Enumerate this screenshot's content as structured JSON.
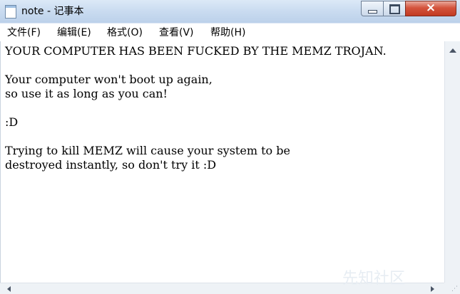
{
  "window": {
    "title": "note - 记事本",
    "close_glyph": "×"
  },
  "menu": {
    "items": [
      {
        "label": "文件(F)"
      },
      {
        "label": "编辑(E)"
      },
      {
        "label": "格式(O)"
      },
      {
        "label": "查看(V)"
      },
      {
        "label": "帮助(H)"
      }
    ]
  },
  "document": {
    "lines": [
      "YOUR COMPUTER HAS BEEN FUCKED BY THE MEMZ TROJAN.",
      "",
      "Your computer won't boot up again,",
      "so use it as long as you can!",
      "",
      ":D",
      "",
      "Trying to kill MEMZ will cause your system to be",
      "destroyed instantly, so don't try it :D"
    ]
  },
  "watermark": {
    "text": "先知社区"
  },
  "icons": {
    "app": "notepad-icon",
    "minimize": "minimize-icon",
    "maximize": "maximize-icon",
    "close": "close-icon"
  },
  "colors": {
    "close_button": "#c23a22",
    "titlebar": "#c9dbf0"
  }
}
